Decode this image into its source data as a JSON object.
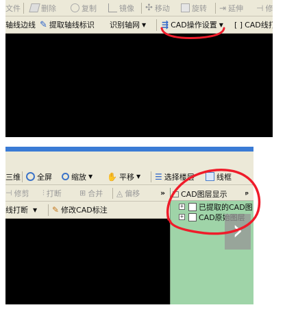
{
  "top_panel": {
    "toolbar1": {
      "file_tab": "文件",
      "delete": "删除",
      "copy": "复制",
      "mirror": "镜像",
      "move": "移动",
      "rotate": "旋转",
      "extend": "延伸",
      "trim": "修"
    },
    "toolbar2": {
      "axis_edge": "轴线边线",
      "extract_axis": "提取轴线标识",
      "identify_axis": "识别轴网",
      "cad_settings": "CAD操作设置",
      "cad_print_prefix": "[ ]",
      "cad_print": "CAD线打"
    }
  },
  "bottom_panel": {
    "toolbar1": {
      "three_d": "三维",
      "fullscreen": "全屏",
      "zoom": "缩放",
      "pan": "平移",
      "select_layer": "选择楼层",
      "wireframe": "线框"
    },
    "toolbar2": {
      "trim": "修剪",
      "break": "打断",
      "merge": "合并",
      "offset": "偏移",
      "more": "»"
    },
    "toolbar3": {
      "axis_break": "线打断",
      "modify_cad_label": "修改CAD标注"
    },
    "layer_panel": {
      "title": "CAD图层显示",
      "pin": "ᵖ",
      "items": [
        {
          "label": "已提取的CAD图",
          "expander": "+"
        },
        {
          "label": "CAD原始图层",
          "expander": "+"
        }
      ]
    },
    "next_arrow": "›"
  },
  "colors": {
    "toolbar_bg": "#ece9d8",
    "canvas": "#000000",
    "layer_panel_bg": "#9fd4a8",
    "highlight_red": "#ef1c2a",
    "title_bar_blue": "#3a7bd5"
  }
}
